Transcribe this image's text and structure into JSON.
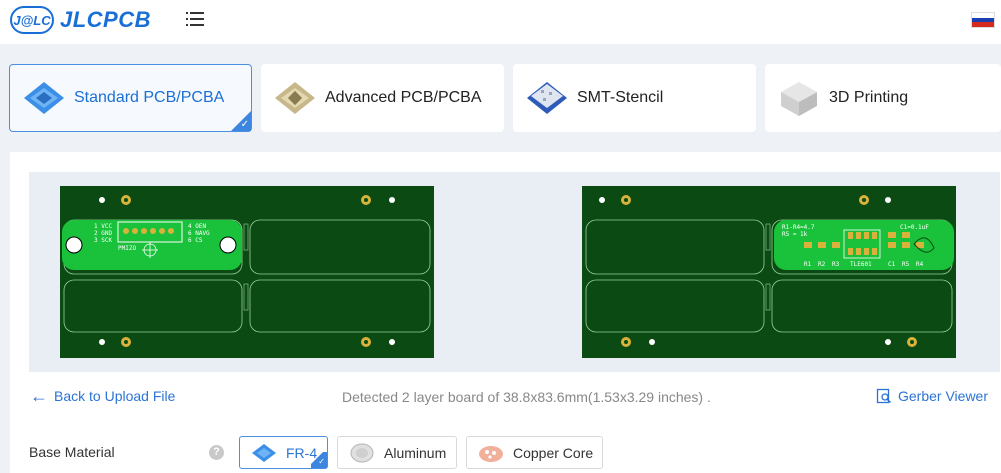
{
  "header": {
    "logo_badge": "J@LC",
    "logo_text": "JLCPCB"
  },
  "tabs": [
    {
      "label": "Standard PCB/PCBA",
      "active": true,
      "icon": "standard-pcb-icon"
    },
    {
      "label": "Advanced PCB/PCBA",
      "active": false,
      "icon": "advanced-pcb-icon"
    },
    {
      "label": "SMT-Stencil",
      "active": false,
      "icon": "smt-stencil-icon"
    },
    {
      "label": "3D Printing",
      "active": false,
      "icon": "3d-printing-icon"
    }
  ],
  "preview": {
    "top_silk": {
      "pins_left": [
        "1 VCC",
        "2 GND",
        "3 SCK"
      ],
      "pins_right": [
        "4 OEN",
        "6 NAVG",
        "6 CS"
      ],
      "part": "PMIZO"
    },
    "bottom_silk": {
      "top_left": "R1-R4=4.7",
      "top_left2": "R5 = 1k",
      "top_right": "C1=0.1uF",
      "bottom_labels": [
        "R1",
        "R2",
        "R3",
        "TLE601",
        "C1",
        "R5",
        "R4"
      ]
    }
  },
  "toolbar": {
    "back_label": "Back to Upload File",
    "detected_text": "Detected 2 layer board of 38.8x83.6mm(1.53x3.29 inches) .",
    "gerber_label": "Gerber Viewer"
  },
  "base_material": {
    "label": "Base Material",
    "help": "?",
    "options": [
      {
        "label": "FR-4",
        "selected": true
      },
      {
        "label": "Aluminum",
        "selected": false
      },
      {
        "label": "Copper Core",
        "selected": false
      }
    ]
  },
  "colors": {
    "accent": "#2b74d4",
    "pcb_green": "#0b4a12",
    "pcb_bright": "#19c23a",
    "pad_gold": "#d8b23a"
  }
}
